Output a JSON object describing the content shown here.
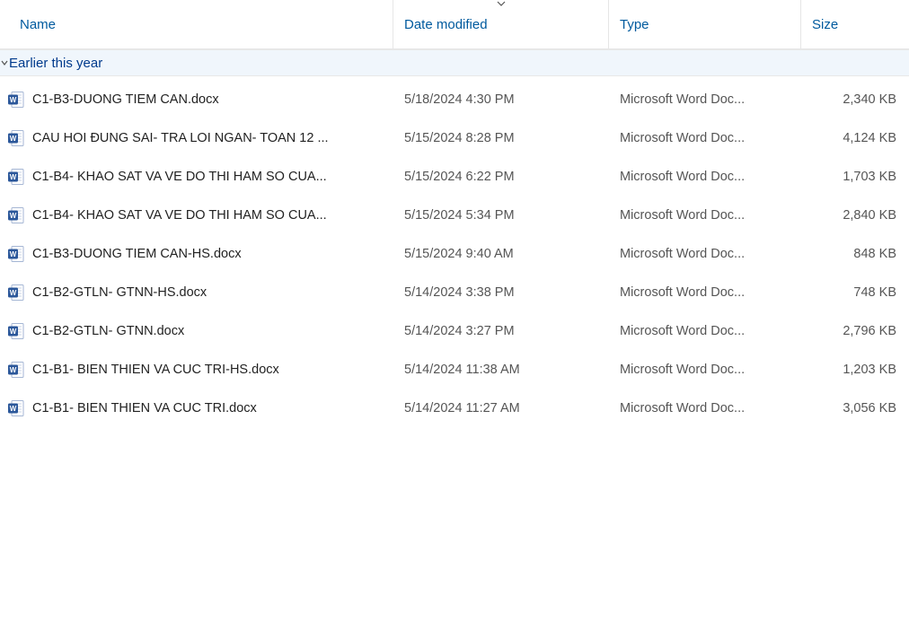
{
  "columns": {
    "name": "Name",
    "date": "Date modified",
    "type": "Type",
    "size": "Size"
  },
  "group": {
    "label": "Earlier this year"
  },
  "files": [
    {
      "name": "C1-B3-DUONG TIEM CAN.docx",
      "date": "5/18/2024 4:30 PM",
      "type": "Microsoft Word Doc...",
      "size": "2,340 KB"
    },
    {
      "name": "CAU HOI ĐUNG SAI- TRA LOI NGAN- TOAN 12 ...",
      "date": "5/15/2024 8:28 PM",
      "type": "Microsoft Word Doc...",
      "size": "4,124 KB"
    },
    {
      "name": "C1-B4- KHAO SAT VA VE DO THI HAM SO CUA...",
      "date": "5/15/2024 6:22 PM",
      "type": "Microsoft Word Doc...",
      "size": "1,703 KB"
    },
    {
      "name": "C1-B4- KHAO SAT VA VE DO THI HAM SO CUA...",
      "date": "5/15/2024 5:34 PM",
      "type": "Microsoft Word Doc...",
      "size": "2,840 KB"
    },
    {
      "name": "C1-B3-DUONG TIEM CAN-HS.docx",
      "date": "5/15/2024 9:40 AM",
      "type": "Microsoft Word Doc...",
      "size": "848 KB"
    },
    {
      "name": "C1-B2-GTLN- GTNN-HS.docx",
      "date": "5/14/2024 3:38 PM",
      "type": "Microsoft Word Doc...",
      "size": "748 KB"
    },
    {
      "name": "C1-B2-GTLN- GTNN.docx",
      "date": "5/14/2024 3:27 PM",
      "type": "Microsoft Word Doc...",
      "size": "2,796 KB"
    },
    {
      "name": "C1-B1- BIEN THIEN VA CUC TRI-HS.docx",
      "date": "5/14/2024 11:38 AM",
      "type": "Microsoft Word Doc...",
      "size": "1,203 KB"
    },
    {
      "name": "C1-B1- BIEN THIEN VA CUC TRI.docx",
      "date": "5/14/2024 11:27 AM",
      "type": "Microsoft Word Doc...",
      "size": "3,056 KB"
    }
  ]
}
